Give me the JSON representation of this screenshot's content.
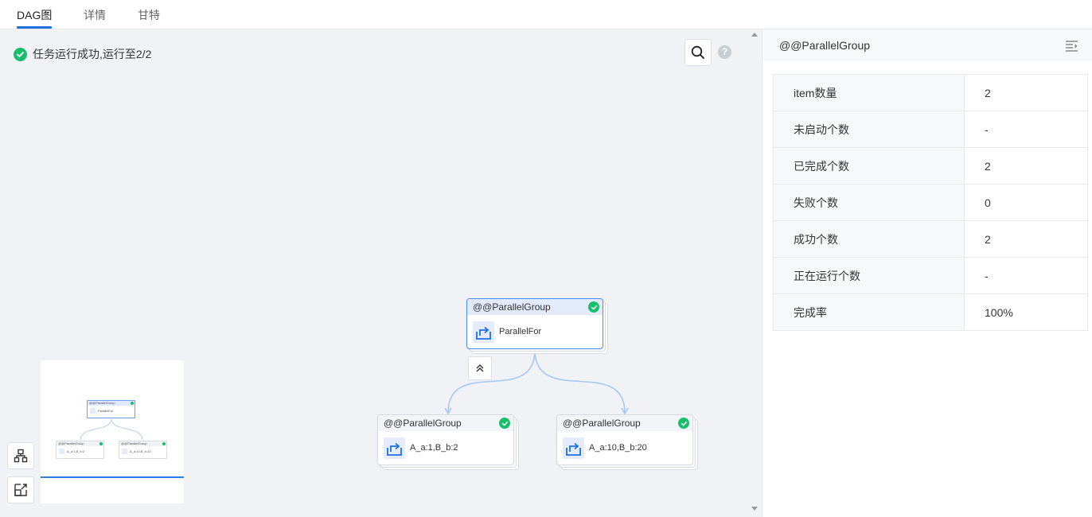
{
  "tabs": [
    {
      "label": "DAG图",
      "active": true
    },
    {
      "label": "详情",
      "active": false
    },
    {
      "label": "甘特",
      "active": false
    }
  ],
  "status": {
    "text": "任务运行成功,运行至2/2",
    "icon": "check-circle-icon",
    "color": "#19be6b"
  },
  "toolbar": {
    "search_icon": "search-icon",
    "help_text": "?"
  },
  "dag": {
    "root": {
      "title": "@@ParallelGroup",
      "label": "ParallelFor",
      "status": "success"
    },
    "children": [
      {
        "title": "@@ParallelGroup",
        "label": "A_a:1,B_b:2",
        "status": "success"
      },
      {
        "title": "@@ParallelGroup",
        "label": "A_a:10,B_b:20",
        "status": "success"
      }
    ],
    "edge_color": "#a6c8f3",
    "accent": "#4a8cf0"
  },
  "minimap": {
    "root": {
      "title": "@@ParallelGroup",
      "label": "ParallelFor"
    },
    "children": [
      {
        "title": "@@ParallelGroup",
        "label": "A_a:1,B_b:2"
      },
      {
        "title": "@@ParallelGroup",
        "label": "A_a:10,B_b:20"
      }
    ]
  },
  "panel": {
    "title": "@@ParallelGroup",
    "menu_icon": "list-collapse-icon",
    "rows": [
      {
        "key": "item数量",
        "value": "2"
      },
      {
        "key": "未启动个数",
        "value": "-"
      },
      {
        "key": "已完成个数",
        "value": "2"
      },
      {
        "key": "失败个数",
        "value": "0"
      },
      {
        "key": "成功个数",
        "value": "2"
      },
      {
        "key": "正在运行个数",
        "value": "-"
      },
      {
        "key": "完成率",
        "value": "100%"
      }
    ]
  }
}
